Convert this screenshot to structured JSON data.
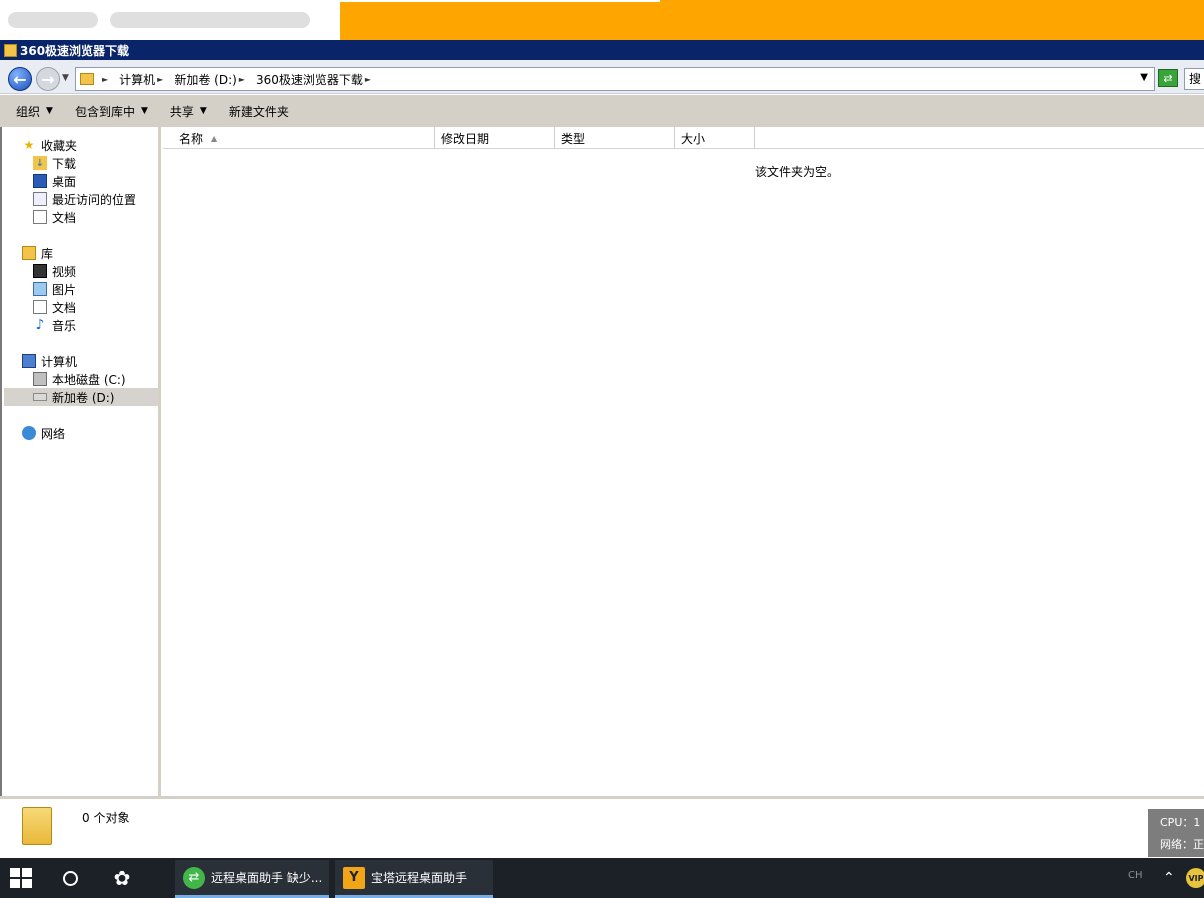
{
  "window": {
    "title": "360极速浏览器下载"
  },
  "address": {
    "breadcrumbs": [
      "计算机",
      "新加卷 (D:)",
      "360极速浏览器下载"
    ]
  },
  "toolbar": {
    "organize": "组织",
    "include_library": "包含到库中",
    "share": "共享",
    "new_folder": "新建文件夹"
  },
  "nav": {
    "favorites": "收藏夹",
    "downloads": "下载",
    "desktop": "桌面",
    "recent": "最近访问的位置",
    "documents_fav": "文档",
    "libraries": "库",
    "videos": "视频",
    "pictures": "图片",
    "documents": "文档",
    "music": "音乐",
    "computer": "计算机",
    "local_disk": "本地磁盘 (C:)",
    "new_volume": "新加卷 (D:)",
    "network": "网络"
  },
  "columns": {
    "name": "名称",
    "modified": "修改日期",
    "type": "类型",
    "size": "大小"
  },
  "content": {
    "empty_message": "该文件夹为空。"
  },
  "details": {
    "object_count": "0 个对象"
  },
  "status_panel": {
    "cpu": "CPU：1",
    "network": "网络：正"
  },
  "taskbar": {
    "app1_label": "远程桌面助手 缺少...",
    "app2_label": "宝塔远程桌面助手",
    "tray_lang": "CH",
    "tray_vip": "VIP"
  },
  "colors": {
    "accent_orange": "#ffa500",
    "title_bar": "#0a246a",
    "taskbar": "#1c2128"
  }
}
